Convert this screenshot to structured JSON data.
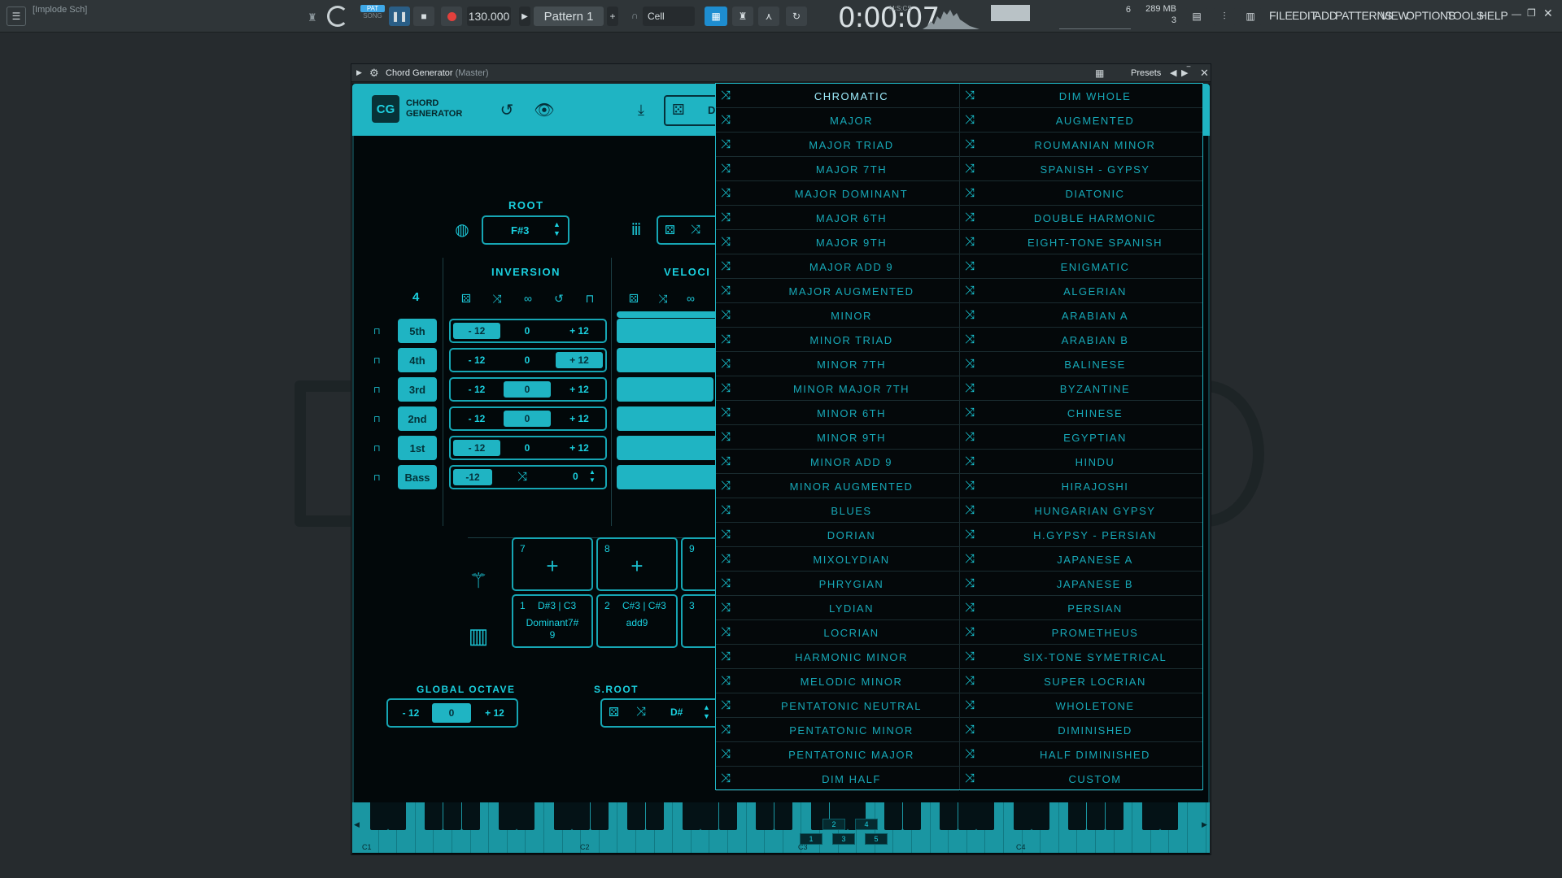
{
  "toolbar": {
    "hint": "[Implode Sch]",
    "pat_label": "PAT",
    "song_label": "SONG",
    "tempo": "130.000",
    "pattern": "Pattern 1",
    "snap": "Cell",
    "time": "0:00:07",
    "time_label": "M:S:CS",
    "memory": "289 MB",
    "voices": "3",
    "cpu": "6",
    "menus": [
      "FILE",
      "EDIT",
      "ADD",
      "PATTERNS",
      "VIEW",
      "OPTIONS",
      "TOOLS",
      "HELP"
    ]
  },
  "window": {
    "title": "Chord Generator",
    "subtitle": "(Master)",
    "presets_label": "Presets"
  },
  "plugin": {
    "logo": "CG",
    "name_line1": "CHORD",
    "name_line2": "GENERATOR",
    "header_partial": "D",
    "root_label": "ROOT",
    "root_value": "F#3",
    "inversion_label": "INVERSION",
    "velocity_label": "VELOCI",
    "voice_count": "4",
    "rows": [
      {
        "note": "5th",
        "left": "- 12",
        "mid": "0",
        "right": "+ 12",
        "active": "left",
        "velocity": 1.0
      },
      {
        "note": "4th",
        "left": "- 12",
        "mid": "0",
        "right": "+ 12",
        "active": "right",
        "velocity": 1.0
      },
      {
        "note": "3rd",
        "left": "- 12",
        "mid": "0",
        "right": "+ 12",
        "active": "mid",
        "velocity": 0.85
      },
      {
        "note": "2nd",
        "left": "- 12",
        "mid": "0",
        "right": "+ 12",
        "active": "mid",
        "velocity": 1.0
      },
      {
        "note": "1st",
        "left": "- 12",
        "mid": "0",
        "right": "+ 12",
        "active": "left",
        "velocity": 1.0
      }
    ],
    "bass": {
      "note": "Bass",
      "left": "-12",
      "value": "0"
    },
    "slots_top": [
      {
        "num": "7"
      },
      {
        "num": "8"
      },
      {
        "num": "9"
      }
    ],
    "slots_bottom": [
      {
        "num": "1",
        "notes": "D#3 | C3",
        "name": "Dominant7#\n9"
      },
      {
        "num": "2",
        "notes": "C#3 | C#3",
        "name": "add9"
      },
      {
        "num": "3",
        "notes": "",
        "name": ""
      }
    ],
    "global_octave_label": "GLOBAL OCTAVE",
    "global_octave": {
      "left": "- 12",
      "mid": "0",
      "right": "+ 12"
    },
    "sroot_label": "S.ROOT",
    "sroot_value": "D#",
    "keyboard": {
      "octave_labels": [
        "C1",
        "C2",
        "C3",
        "C4"
      ],
      "degrees_top": [
        "2",
        "4"
      ],
      "degrees_bottom": [
        "1",
        "3",
        "5"
      ]
    }
  },
  "scales": {
    "selected": "CHROMATIC",
    "left": [
      "CHROMATIC",
      "MAJOR",
      "MAJOR TRIAD",
      "MAJOR 7TH",
      "MAJOR DOMINANT",
      "MAJOR 6TH",
      "MAJOR 9TH",
      "MAJOR ADD 9",
      "MAJOR AUGMENTED",
      "MINOR",
      "MINOR TRIAD",
      "MINOR 7TH",
      "MINOR MAJOR 7TH",
      "MINOR 6TH",
      "MINOR 9TH",
      "MINOR ADD 9",
      "MINOR AUGMENTED",
      "BLUES",
      "DORIAN",
      "MIXOLYDIAN",
      "PHRYGIAN",
      "LYDIAN",
      "LOCRIAN",
      "HARMONIC MINOR",
      "MELODIC MINOR",
      "PENTATONIC NEUTRAL",
      "PENTATONIC MINOR",
      "PENTATONIC MAJOR",
      "DIM HALF"
    ],
    "right": [
      "DIM WHOLE",
      "AUGMENTED",
      "ROUMANIAN MINOR",
      "SPANISH - GYPSY",
      "DIATONIC",
      "DOUBLE HARMONIC",
      "EIGHT-TONE SPANISH",
      "ENIGMATIC",
      "ALGERIAN",
      "ARABIAN A",
      "ARABIAN B",
      "BALINESE",
      "BYZANTINE",
      "CHINESE",
      "EGYPTIAN",
      "HINDU",
      "HIRAJOSHI",
      "HUNGARIAN GYPSY",
      "H.GYPSY - PERSIAN",
      "JAPANESE A",
      "JAPANESE B",
      "PERSIAN",
      "PROMETHEUS",
      "SIX-TONE SYMETRICAL",
      "SUPER LOCRIAN",
      "WHOLETONE",
      "DIMINISHED",
      "HALF DIMINISHED",
      "CUSTOM"
    ]
  },
  "colors": {
    "accent": "#1fb4c3",
    "panel": "#02080a",
    "text_teal": "#1ad0df"
  }
}
